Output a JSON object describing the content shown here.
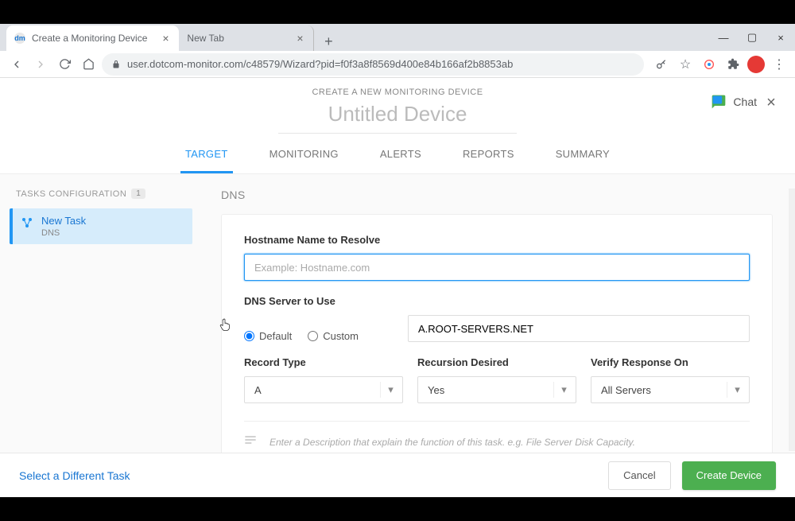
{
  "browser": {
    "tabs": [
      {
        "title": "Create a Monitoring Device",
        "favicon_letters": "dm",
        "favicon_bg": "#e0e0e0",
        "favicon_fg": "#1976d2"
      },
      {
        "title": "New Tab"
      }
    ],
    "url": "user.dotcom-monitor.com/c48579/Wizard?pid=f0f3a8f8569d400e84b166af2b8853ab"
  },
  "header": {
    "label": "CREATE A NEW MONITORING DEVICE",
    "title": "Untitled Device",
    "chat": "Chat"
  },
  "wizard_tabs": [
    "TARGET",
    "MONITORING",
    "ALERTS",
    "REPORTS",
    "SUMMARY"
  ],
  "sidebar": {
    "heading": "TASKS CONFIGURATION",
    "count": "1",
    "item": {
      "title": "New Task",
      "sub": "DNS"
    }
  },
  "main": {
    "section": "DNS",
    "hostname_label": "Hostname Name to Resolve",
    "hostname_placeholder": "Example: Hostname.com",
    "dns_server_label": "DNS Server to Use",
    "radio_default": "Default",
    "radio_custom": "Custom",
    "dns_server_value": "A.ROOT-SERVERS.NET",
    "record_type_label": "Record Type",
    "record_type_value": "A",
    "recursion_label": "Recursion Desired",
    "recursion_value": "Yes",
    "verify_label": "Verify Response On",
    "verify_value": "All Servers",
    "desc_placeholder": "Enter a Description that explain the function of this task. e.g. File Server Disk Capacity."
  },
  "footer": {
    "select_task": "Select a Different Task",
    "cancel": "Cancel",
    "create": "Create Device"
  }
}
